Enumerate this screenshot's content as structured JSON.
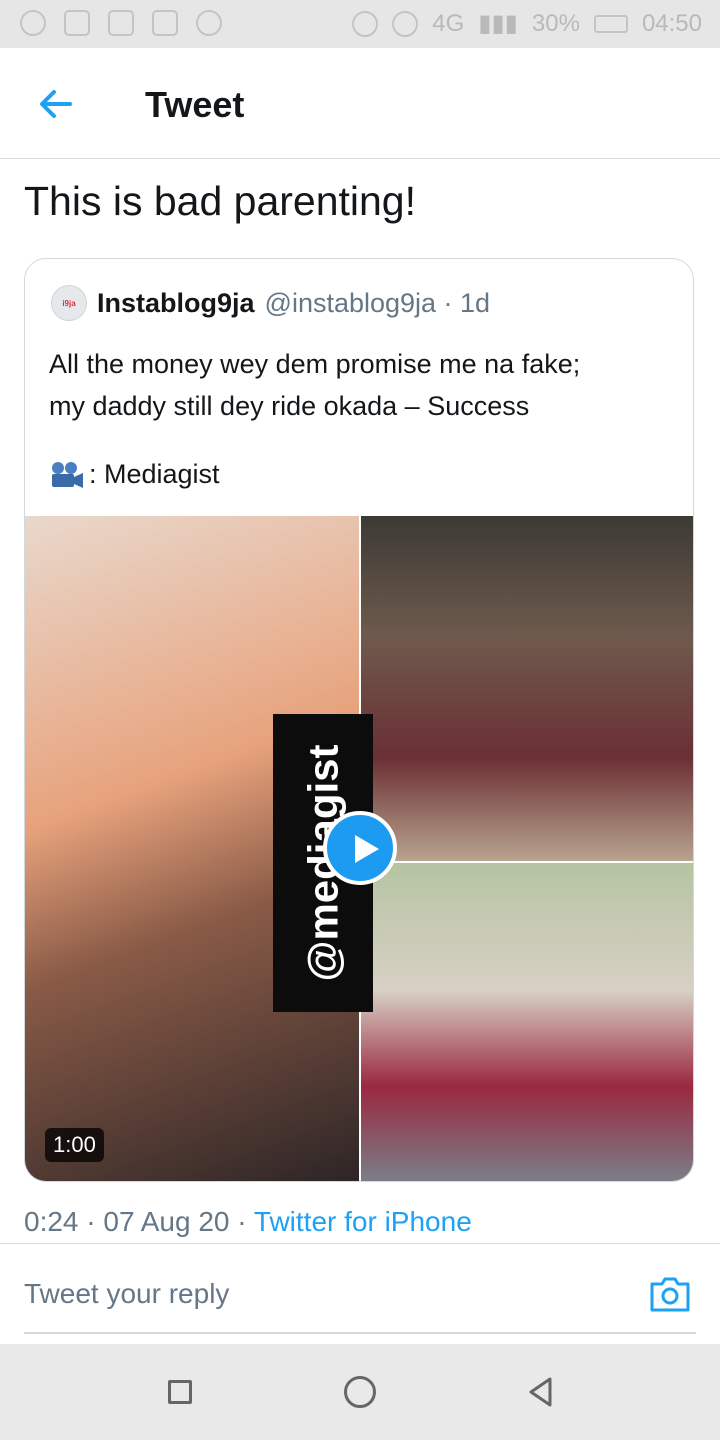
{
  "status_bar": {
    "network": "4G",
    "battery": "30%",
    "time": "04:50"
  },
  "header": {
    "title": "Tweet",
    "back_icon": "back-arrow-icon"
  },
  "tweet": {
    "text": "This is bad parenting!",
    "meta_time": "0:24 · 07 Aug 20 · ",
    "meta_app": "Twitter for iPhone"
  },
  "quoted_tweet": {
    "name": "Instablog9ja",
    "handle": "@instablog9ja · 1d",
    "body_line1": "All the money wey dem promise me na fake;",
    "body_line2": "my daddy still dey ride okada – Success",
    "credit": ": Mediagist",
    "media": {
      "watermark": "@mediagist",
      "duration": "1:00"
    }
  },
  "reply": {
    "placeholder": "Tweet your reply",
    "camera_icon": "camera-icon"
  },
  "colors": {
    "accent": "#1da1f2",
    "text": "#14171a",
    "secondary": "#657786"
  }
}
